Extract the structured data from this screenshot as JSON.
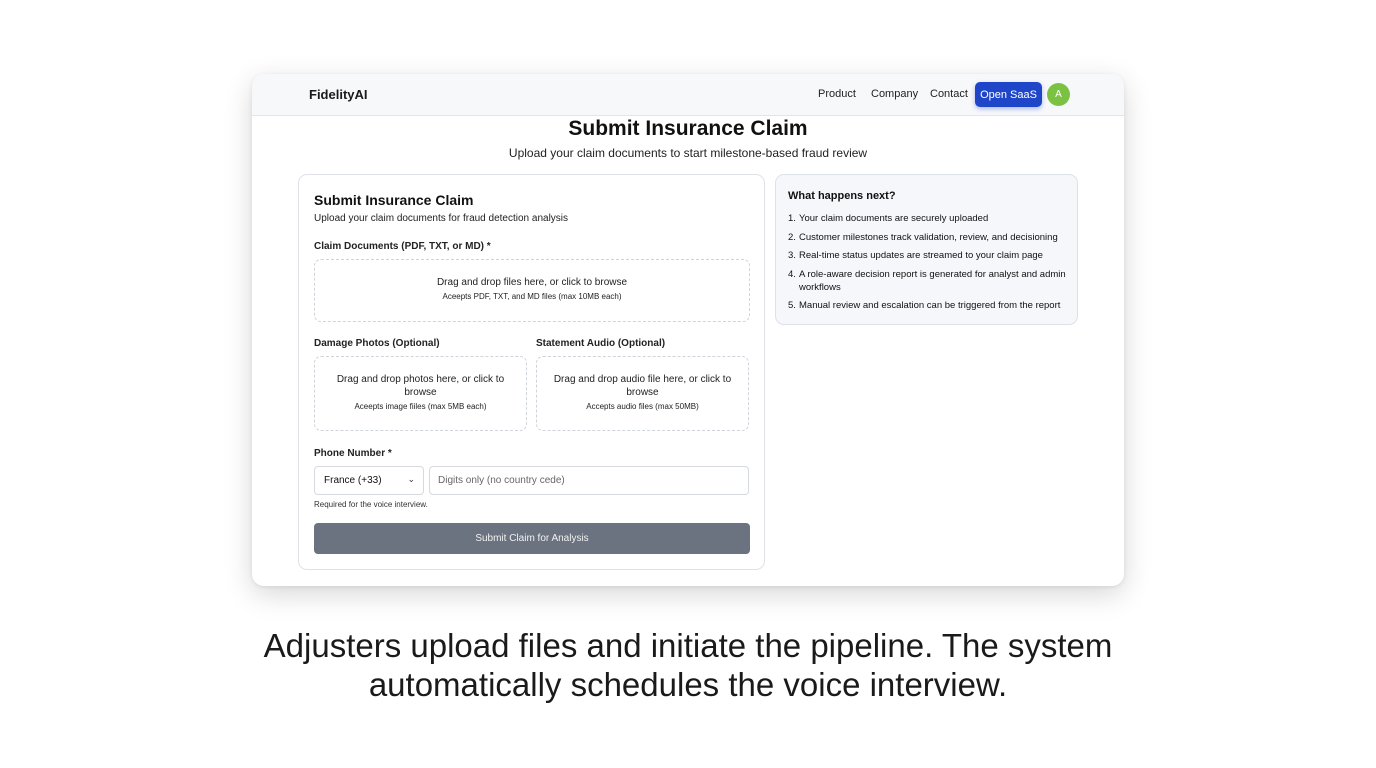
{
  "navbar": {
    "brand": "FidelityAI",
    "links": [
      "Product",
      "Company",
      "Contact"
    ],
    "open_saas_label": "Open SaaS",
    "avatar_initial": "A"
  },
  "page": {
    "title": "Submit Insurance Claim",
    "subtitle": "Upload your claim documents to start milestone-based fraud review"
  },
  "form": {
    "title": "Submit Insurance Claim",
    "subtitle": "Upload your claim documents for fraud detection analysis",
    "claim_documents": {
      "label": "Claim Documents (PDF, TXT, or MD) *",
      "drop_text": "Drag and drop files here, or click to browse",
      "accepts": "Aceepts PDF, TXT, and MD files (max 10MB each)"
    },
    "damage_photos": {
      "label": "Damage Photos (Optional)",
      "drop_text": "Drag and drop photos here, or click to browse",
      "accepts": "Aceepts image fiiles (max 5MB each)"
    },
    "statement_audio": {
      "label": "Statement Audio (Optional)",
      "drop_text": "Drag and drop audio file here, or click to browse",
      "accepts": "Accepts audio files (max 50MB)"
    },
    "phone": {
      "label": "Phone Number *",
      "country_selected": "France (+33)",
      "placeholder": "Digits only (no country cede)",
      "helper": "Required for the voice interview."
    },
    "submit_label": "Submit Claim for Analysis"
  },
  "info": {
    "title": "What happens next?",
    "steps": [
      "Your claim documents are securely uploaded",
      "Customer milestones track validation, review, and decisioning",
      "Real-time status updates are streamed to your claim page",
      "A role-aware decision report is generated for analyst and admin workflows",
      "Manual review and escalation can be triggered from the report"
    ]
  },
  "caption": {
    "line1": "Adjusters upload files and initiate the pipeline. The system",
    "line2": "automatically schedules the voice interview."
  },
  "colors": {
    "accent": "#1f46c9",
    "avatar": "#7cc242",
    "submit_button": "#6b7280"
  },
  "icons": {
    "select_caret": "chevron-down-icon"
  }
}
